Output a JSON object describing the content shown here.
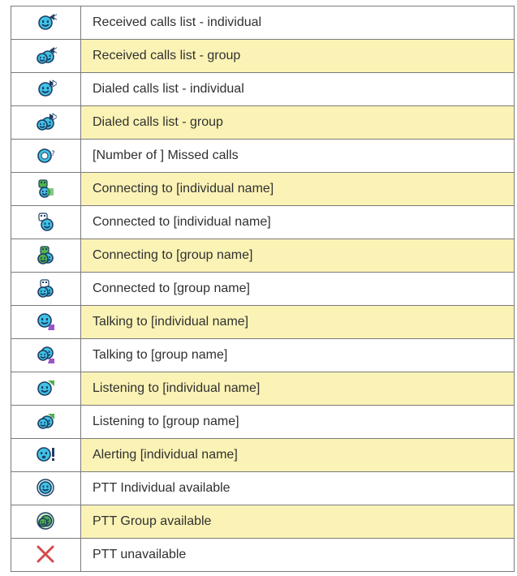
{
  "colors": {
    "highlight_row": "#fbf3b6",
    "border": "#7a7a7a",
    "icon_cyan": "#3fc3e6",
    "icon_green": "#4fb34b",
    "icon_dark": "#1f3d63",
    "purple": "#9a55c9",
    "red_x": "#d24b4b"
  },
  "rows": [
    {
      "icon": "received-calls-individual-icon",
      "label": "Received calls list - individual",
      "highlight": false
    },
    {
      "icon": "received-calls-group-icon",
      "label": "Received calls list - group",
      "highlight": true
    },
    {
      "icon": "dialed-calls-individual-icon",
      "label": "Dialed calls list - individual",
      "highlight": false
    },
    {
      "icon": "dialed-calls-group-icon",
      "label": "Dialed calls list - group",
      "highlight": true
    },
    {
      "icon": "missed-calls-icon",
      "label": "[Number of ] Missed calls",
      "highlight": false
    },
    {
      "icon": "connecting-individual-icon",
      "label": "Connecting to [individual name]",
      "highlight": true
    },
    {
      "icon": "connected-individual-icon",
      "label": "Connected to [individual name]",
      "highlight": false
    },
    {
      "icon": "connecting-group-icon",
      "label": "Connecting to [group name]",
      "highlight": true
    },
    {
      "icon": "connected-group-icon",
      "label": "Connected to [group name]",
      "highlight": false
    },
    {
      "icon": "talking-individual-icon",
      "label": "Talking to [individual name]",
      "highlight": true
    },
    {
      "icon": "talking-group-icon",
      "label": "Talking to [group name]",
      "highlight": false
    },
    {
      "icon": "listening-individual-icon",
      "label": "Listening to [individual name]",
      "highlight": true
    },
    {
      "icon": "listening-group-icon",
      "label": "Listening to [group name]",
      "highlight": false
    },
    {
      "icon": "alerting-individual-icon",
      "label": "Alerting [individual name]",
      "highlight": true
    },
    {
      "icon": "ptt-individual-available-icon",
      "label": "PTT Individual available",
      "highlight": false
    },
    {
      "icon": "ptt-group-available-icon",
      "label": "PTT Group available",
      "highlight": true
    },
    {
      "icon": "ptt-unavailable-icon",
      "label": "PTT unavailable",
      "highlight": false
    }
  ]
}
